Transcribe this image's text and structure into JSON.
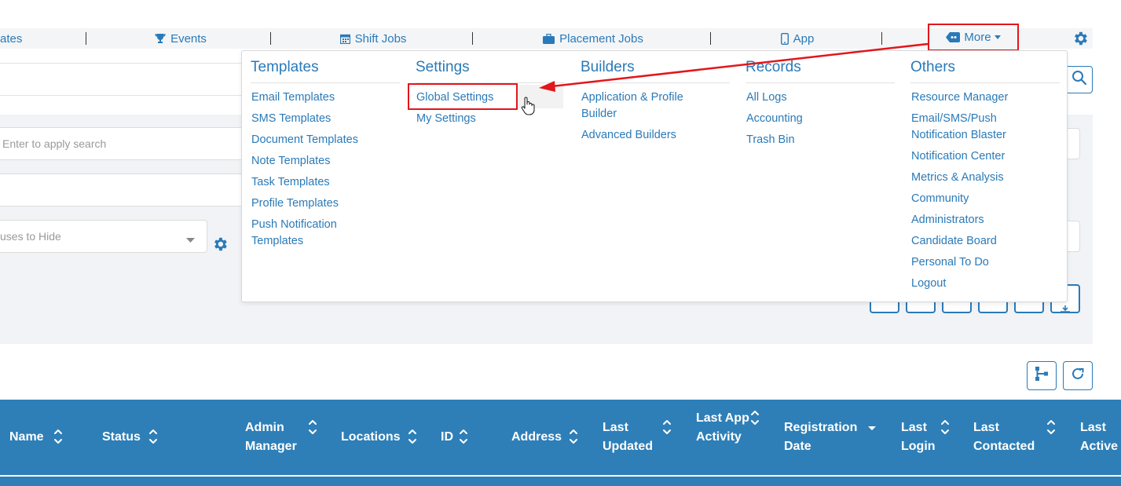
{
  "nav": {
    "items": [
      {
        "label": "ates",
        "icon": "none"
      },
      {
        "label": "Events",
        "icon": "trophy-icon"
      },
      {
        "label": "Shift Jobs",
        "icon": "calendar-icon"
      },
      {
        "label": "Placement Jobs",
        "icon": "briefcase-icon"
      },
      {
        "label": "App",
        "icon": "mobile-icon"
      }
    ],
    "more_label": "More",
    "accent": "#2a7ab8",
    "highlight": "#e3161b"
  },
  "filters": {
    "search_placeholder": "Enter to apply search",
    "statuses_placeholder": "uses to Hide"
  },
  "dropdown": {
    "templates": {
      "title": "Templates",
      "items": [
        "Email Templates",
        "SMS Templates",
        "Document Templates",
        "Note Templates",
        "Task Templates",
        "Profile Templates",
        "Push Notification Templates"
      ]
    },
    "settings": {
      "title": "Settings",
      "items": [
        "Global Settings",
        "My Settings"
      ]
    },
    "builders": {
      "title": "Builders",
      "items": [
        "Application & Profile Builder",
        "Advanced Builders"
      ]
    },
    "records": {
      "title": "Records",
      "items": [
        "All Logs",
        "Accounting",
        "Trash Bin"
      ]
    },
    "others": {
      "title": "Others",
      "items": [
        "Resource Manager",
        "Email/SMS/Push Notification Blaster",
        "Notification Center",
        "Metrics & Analysis",
        "Community",
        "Administrators",
        "Candidate Board",
        "Personal To Do",
        "Logout"
      ]
    }
  },
  "table": {
    "header_color": "#2e7fb8",
    "columns": [
      {
        "label": "Name"
      },
      {
        "label": "Status"
      },
      {
        "label": "Admin Manager"
      },
      {
        "label": "Locations"
      },
      {
        "label": "ID"
      },
      {
        "label": "Address"
      },
      {
        "label": "Last Updated"
      },
      {
        "label": "Last App Activity"
      },
      {
        "label": "Registration Date",
        "sorted": "desc"
      },
      {
        "label": "Last Login"
      },
      {
        "label": "Last Contacted"
      },
      {
        "label": "Last Active"
      }
    ]
  }
}
